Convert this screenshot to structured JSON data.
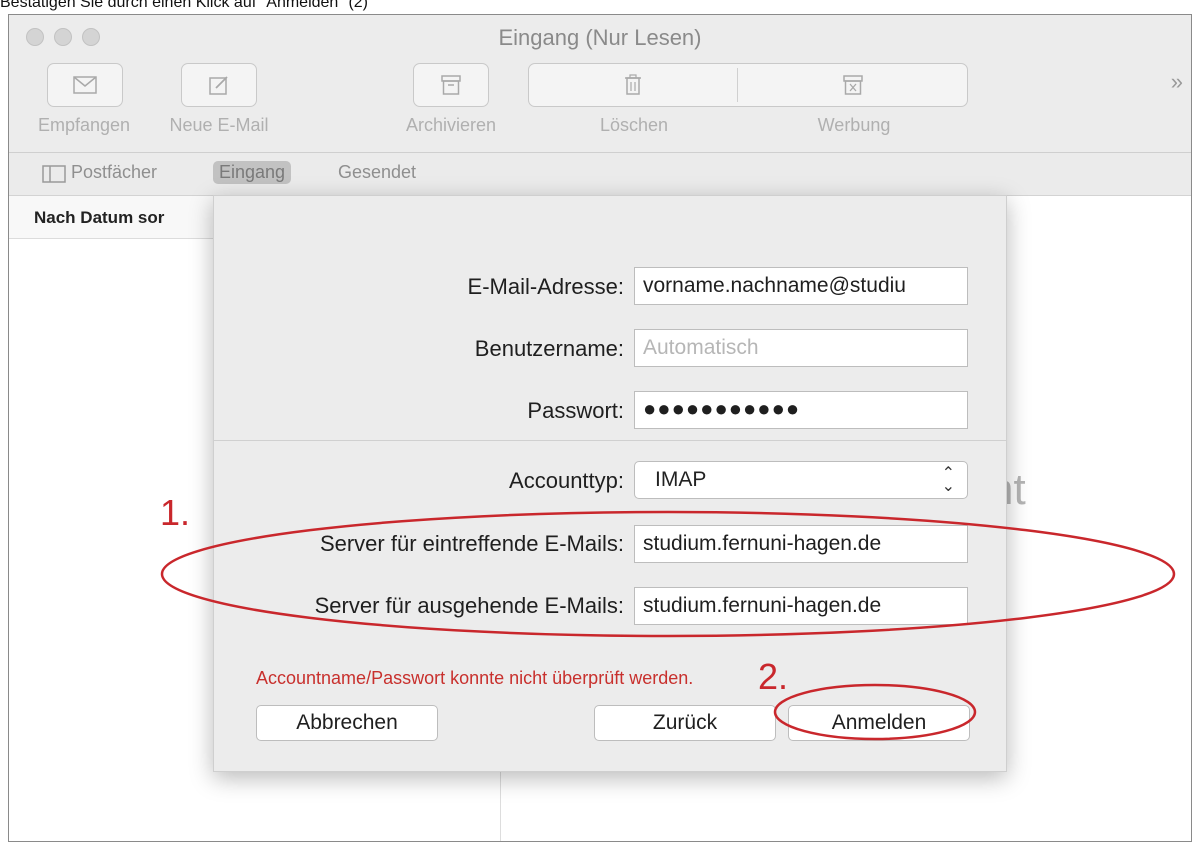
{
  "caption": "Bestätigen Sie durch einen Klick auf \"Anmelden\" (2)",
  "window": {
    "title": "Eingang (Nur Lesen)",
    "toolbar": {
      "receive": "Empfangen",
      "new_mail": "Neue E-Mail",
      "archive": "Archivieren",
      "delete": "Löschen",
      "junk": "Werbung",
      "overflow": "»"
    },
    "favorites": {
      "mailboxes": "Postfächer",
      "inbox": "Eingang",
      "sent": "Gesendet"
    },
    "sort_label": "Nach Datum sor",
    "background_text": "nt"
  },
  "sheet": {
    "email_label": "E-Mail-Adresse:",
    "email_value": "vorname.nachname@studiu",
    "username_label": "Benutzername:",
    "username_placeholder": "Automatisch",
    "password_label": "Passwort:",
    "password_value": "●●●●●●●●●●●",
    "account_type_label": "Accounttyp:",
    "account_type_value": "IMAP",
    "incoming_label": "Server für eintreffende E-Mails:",
    "incoming_value": "studium.fernuni-hagen.de",
    "outgoing_label": "Server für ausgehende E-Mails:",
    "outgoing_value": "studium.fernuni-hagen.de",
    "error": "Accountname/Passwort konnte nicht überprüft werden.",
    "cancel": "Abbrechen",
    "back": "Zurück",
    "login": "Anmelden"
  },
  "annotations": {
    "step1": "1.",
    "step2": "2.",
    "color": "#c9272c"
  },
  "icons": [
    "envelope-icon",
    "compose-icon",
    "archive-box-icon",
    "trash-icon",
    "junk-box-icon",
    "sidebar-icon",
    "chevron-updown-icon"
  ]
}
